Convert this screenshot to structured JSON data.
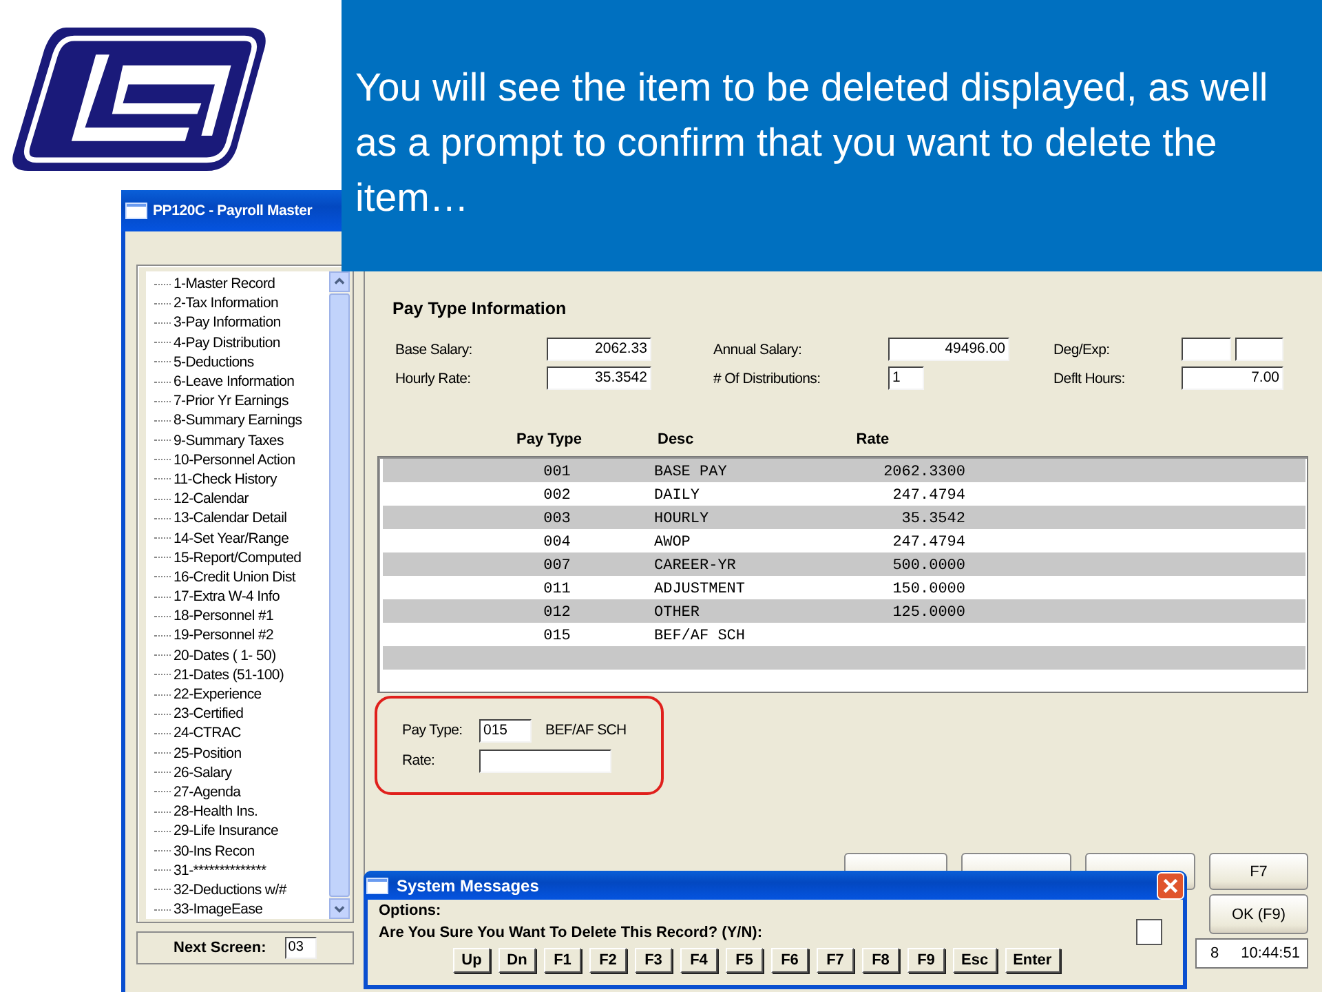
{
  "callout": {
    "text": "You will see the item to be deleted displayed, as well as a prompt to confirm that you want to delete the item…"
  },
  "window": {
    "title": "PP120C - Payroll Master"
  },
  "screens": [
    {
      "label": "1-Master Record"
    },
    {
      "label": "2-Tax Information"
    },
    {
      "label": "3-Pay Information"
    },
    {
      "label": "4-Pay Distribution"
    },
    {
      "label": "5-Deductions"
    },
    {
      "label": "6-Leave Information"
    },
    {
      "label": "7-Prior Yr Earnings"
    },
    {
      "label": "8-Summary Earnings"
    },
    {
      "label": "9-Summary Taxes"
    },
    {
      "label": "10-Personnel Action"
    },
    {
      "label": "11-Check History"
    },
    {
      "label": "12-Calendar"
    },
    {
      "label": "13-Calendar Detail"
    },
    {
      "label": "14-Set Year/Range"
    },
    {
      "label": "15-Report/Computed"
    },
    {
      "label": "16-Credit Union Dist"
    },
    {
      "label": "17-Extra W-4 Info"
    },
    {
      "label": "18-Personnel #1"
    },
    {
      "label": "19-Personnel #2"
    },
    {
      "label": "20-Dates ( 1- 50)"
    },
    {
      "label": "21-Dates (51-100)"
    },
    {
      "label": "22-Experience"
    },
    {
      "label": "23-Certified"
    },
    {
      "label": "24-CTRAC"
    },
    {
      "label": "25-Position"
    },
    {
      "label": "26-Salary"
    },
    {
      "label": "27-Agenda"
    },
    {
      "label": "28-Health Ins."
    },
    {
      "label": "29-Life Insurance"
    },
    {
      "label": "30-Ins Recon"
    },
    {
      "label": "31-**************"
    },
    {
      "label": "32-Deductions w/#"
    },
    {
      "label": "33-ImageEase"
    }
  ],
  "next_screen": {
    "label": "Next Screen:",
    "value": "03"
  },
  "section_title": "Pay Type Information",
  "fields": [
    {
      "label": "Base Salary:",
      "value": "2062.33"
    },
    {
      "label": "Annual Salary:",
      "value": "49496.00"
    },
    {
      "label": "Deg/Exp:",
      "kind": "pair"
    },
    {
      "label": "Hourly Rate:",
      "value": "35.3542"
    },
    {
      "label": "# Of Distributions:",
      "value": "1",
      "kind": "short"
    },
    {
      "label": "Deflt Hours:",
      "value": "7.00"
    }
  ],
  "table": {
    "columns": [
      "Pay Type",
      "Desc",
      "Rate"
    ],
    "rows": [
      [
        "001",
        "BASE PAY",
        "2062.3300"
      ],
      [
        "002",
        "DAILY",
        "247.4794"
      ],
      [
        "003",
        "HOURLY",
        "35.3542"
      ],
      [
        "004",
        "AWOP",
        "247.4794"
      ],
      [
        "007",
        "CAREER-YR",
        "500.0000"
      ],
      [
        "011",
        "ADJUSTMENT",
        "150.0000"
      ],
      [
        "012",
        "OTHER",
        "125.0000"
      ],
      [
        "015",
        "BEF/AF SCH"
      ]
    ]
  },
  "edit": {
    "pay_type_label": "Pay Type:",
    "pay_type": "015",
    "pay_type_desc": "BEF/AF SCH",
    "rate_label": "Rate:"
  },
  "buttons": [
    {
      "kind": "covered"
    },
    {
      "kind": "covered"
    },
    {
      "kind": "covered"
    },
    {
      "kind": "text",
      "label": "F7"
    },
    {
      "kind": "text",
      "label": "OK (F9)"
    }
  ],
  "status_bar": {
    "date": "8",
    "time": "10:44:51"
  },
  "dialog": {
    "title": "System Messages",
    "options_label": "Options:",
    "question": "Are You Sure You Want To Delete This Record? (Y/N):",
    "keys": [
      "Up",
      "Dn",
      "F1",
      "F2",
      "F3",
      "F4",
      "F5",
      "F6",
      "F7",
      "F8",
      "F9",
      "Esc",
      "Enter"
    ]
  }
}
